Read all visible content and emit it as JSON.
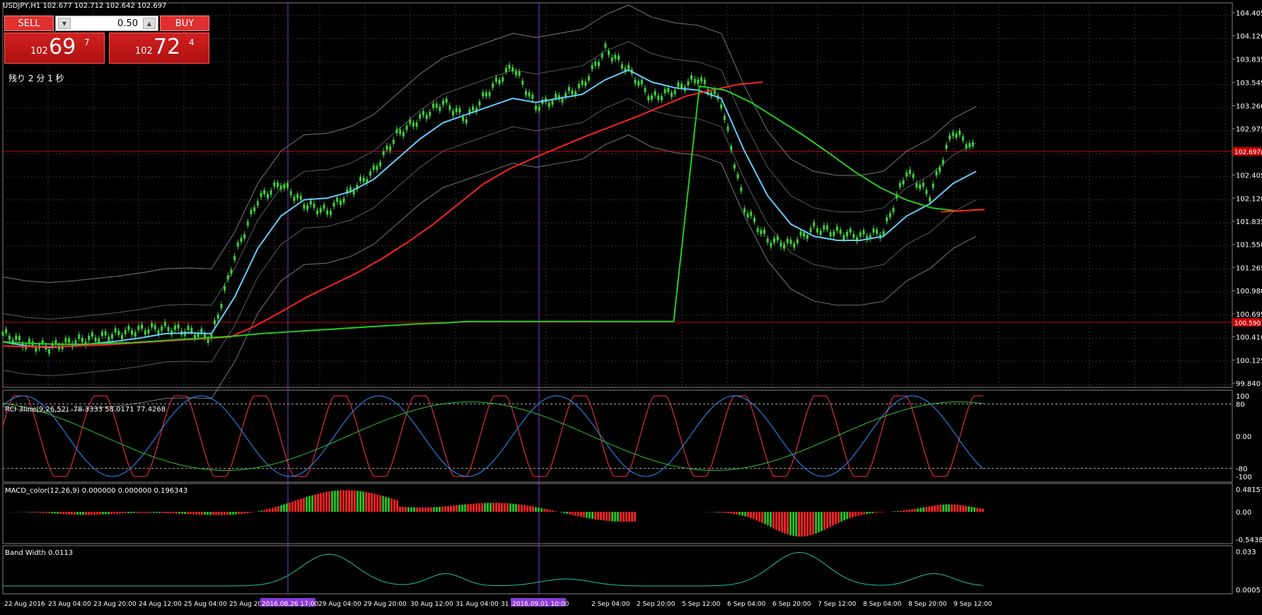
{
  "title": "USDJPY,H1  102.677 102.712 102.642 102.697",
  "trade": {
    "sell": "SELL",
    "buy": "BUY",
    "lot": "0.50",
    "sell_big": "102",
    "sell_main": "69",
    "sell_sup": "7",
    "buy_big": "102",
    "buy_main": "72",
    "buy_sup": "4",
    "timer": "残り 2 分 1 秒"
  },
  "chart_data": [
    {
      "type": "line",
      "title": "USDJPY,H1",
      "ylim": [
        99.84,
        104.44
      ],
      "yticks": [
        "104.405",
        "104.120",
        "103.835",
        "103.545",
        "103.260",
        "102.975",
        "102.690",
        "102.405",
        "102.120",
        "101.835",
        "101.550",
        "101.265",
        "100.980",
        "100.695",
        "100.410",
        "100.125",
        "99.840"
      ],
      "hlines": [
        {
          "value": 102.697,
          "label": "102.697",
          "color": "#cc0000"
        },
        {
          "value": 100.59,
          "label": "100.590",
          "color": "#cc0000"
        }
      ],
      "x_labels": [
        "22 Aug 2016",
        "23 Aug 04:00",
        "23 Aug 20:00",
        "24 Aug 12:00",
        "25 Aug 04:00",
        "25 Aug 20:00",
        "2016.08.26 17:00",
        "29 Aug 04:00",
        "29 Aug 20:00",
        "30 Aug 12:00",
        "31 Aug 04:00",
        "31 A",
        "2016.09.01 10:00",
        "2 Sep 04:00",
        "2 Sep 20:00",
        "5 Sep 12:00",
        "6 Sep 04:00",
        "6 Sep 20:00",
        "7 Sep 12:00",
        "8 Sep 04:00",
        "8 Sep 20:00",
        "9 Sep 12:00"
      ],
      "series": [
        {
          "color": "#3cd03c",
          "values": [
            100.45,
            100.32,
            100.28,
            100.35,
            100.4,
            100.45,
            100.5,
            100.52,
            100.48,
            100.4,
            101.4,
            102.1,
            102.3,
            102.05,
            101.95,
            102.2,
            102.45,
            102.9,
            103.1,
            103.3,
            103.1,
            103.45,
            103.75,
            103.25,
            103.35,
            103.5,
            103.95,
            103.7,
            103.35,
            103.45,
            103.6,
            103.3,
            102.0,
            101.6,
            101.55,
            101.75,
            101.7,
            101.65,
            101.7,
            102.45,
            102.15,
            102.95,
            102.7
          ]
        },
        {
          "color": "#66ccff",
          "values": [
            100.35,
            100.3,
            100.28,
            100.3,
            100.33,
            100.36,
            100.4,
            100.45,
            100.46,
            100.45,
            100.9,
            101.5,
            101.9,
            102.1,
            102.12,
            102.2,
            102.35,
            102.6,
            102.85,
            103.05,
            103.15,
            103.25,
            103.35,
            103.3,
            103.35,
            103.4,
            103.58,
            103.7,
            103.55,
            103.48,
            103.45,
            103.35,
            102.7,
            102.15,
            101.8,
            101.65,
            101.6,
            101.6,
            101.65,
            101.9,
            102.05,
            102.3,
            102.45
          ]
        },
        {
          "color": "#ff2020",
          "values": [
            100.3,
            100.29,
            100.29,
            100.3,
            100.31,
            100.33,
            100.35,
            100.37,
            100.39,
            100.41,
            100.55,
            100.72,
            100.9,
            101.05,
            101.2,
            101.38,
            101.58,
            101.8,
            102.05,
            102.3,
            102.48,
            102.62,
            102.75,
            102.88,
            103.0,
            103.12,
            103.25,
            103.38,
            103.45,
            103.52,
            103.55
          ]
        },
        {
          "color": "#22cc22",
          "values": [
            100.35,
            100.33,
            100.32,
            100.32,
            100.33,
            100.34,
            100.36,
            100.38,
            100.4,
            100.42,
            100.45,
            100.47,
            100.49,
            100.51,
            100.53,
            100.55,
            100.57,
            100.58,
            100.6,
            100.6,
            100.6,
            100.6,
            100.6,
            100.6,
            100.6,
            100.6,
            100.6,
            103.5,
            103.45,
            103.3,
            103.1,
            102.9,
            102.68,
            102.45,
            102.25,
            102.1,
            102.0,
            101.96,
            101.98
          ]
        }
      ]
    },
    {
      "type": "line",
      "title": "RCI 3line(9,26,52) -78.3333 58.0171 77.4268",
      "ylim": [
        -100,
        100
      ],
      "yticks": [
        "100",
        "80",
        "0.00",
        "-80",
        "-100"
      ]
    },
    {
      "type": "bar",
      "title": "MACD_color(12,26,9) 0.000000 0.000000 0.196343",
      "yticks": [
        "0.481578",
        "0.00",
        "-0.543859"
      ]
    },
    {
      "type": "line",
      "title": "Band Width 0.0113",
      "yticks": [
        "0.033",
        "0.0005"
      ]
    }
  ]
}
